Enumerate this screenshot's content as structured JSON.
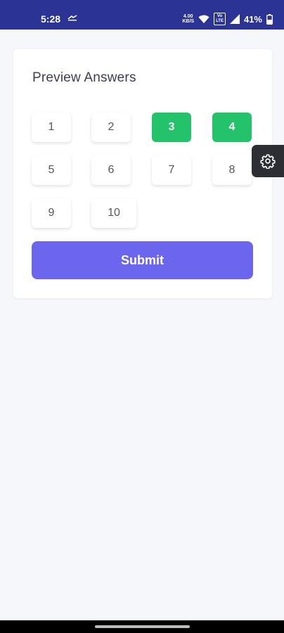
{
  "status_bar": {
    "time": "5:28",
    "net_speed_value": "4.00",
    "net_speed_unit": "KB/S",
    "volte_top": "Vo",
    "volte_bottom": "LTE",
    "battery": "41%",
    "background_color": "#2b3494"
  },
  "card": {
    "title": "Preview Answers"
  },
  "answers": [
    {
      "label": "1",
      "selected": false
    },
    {
      "label": "2",
      "selected": false
    },
    {
      "label": "3",
      "selected": true
    },
    {
      "label": "4",
      "selected": true
    },
    {
      "label": "5",
      "selected": false
    },
    {
      "label": "6",
      "selected": false
    },
    {
      "label": "7",
      "selected": false
    },
    {
      "label": "8",
      "selected": false
    },
    {
      "label": "9",
      "selected": false
    },
    {
      "label": "10",
      "selected": false
    }
  ],
  "submit": {
    "label": "Submit",
    "color": "#6c66ef"
  },
  "selected_color": "#23c26b",
  "settings_tab": {
    "icon": "gear-icon"
  }
}
